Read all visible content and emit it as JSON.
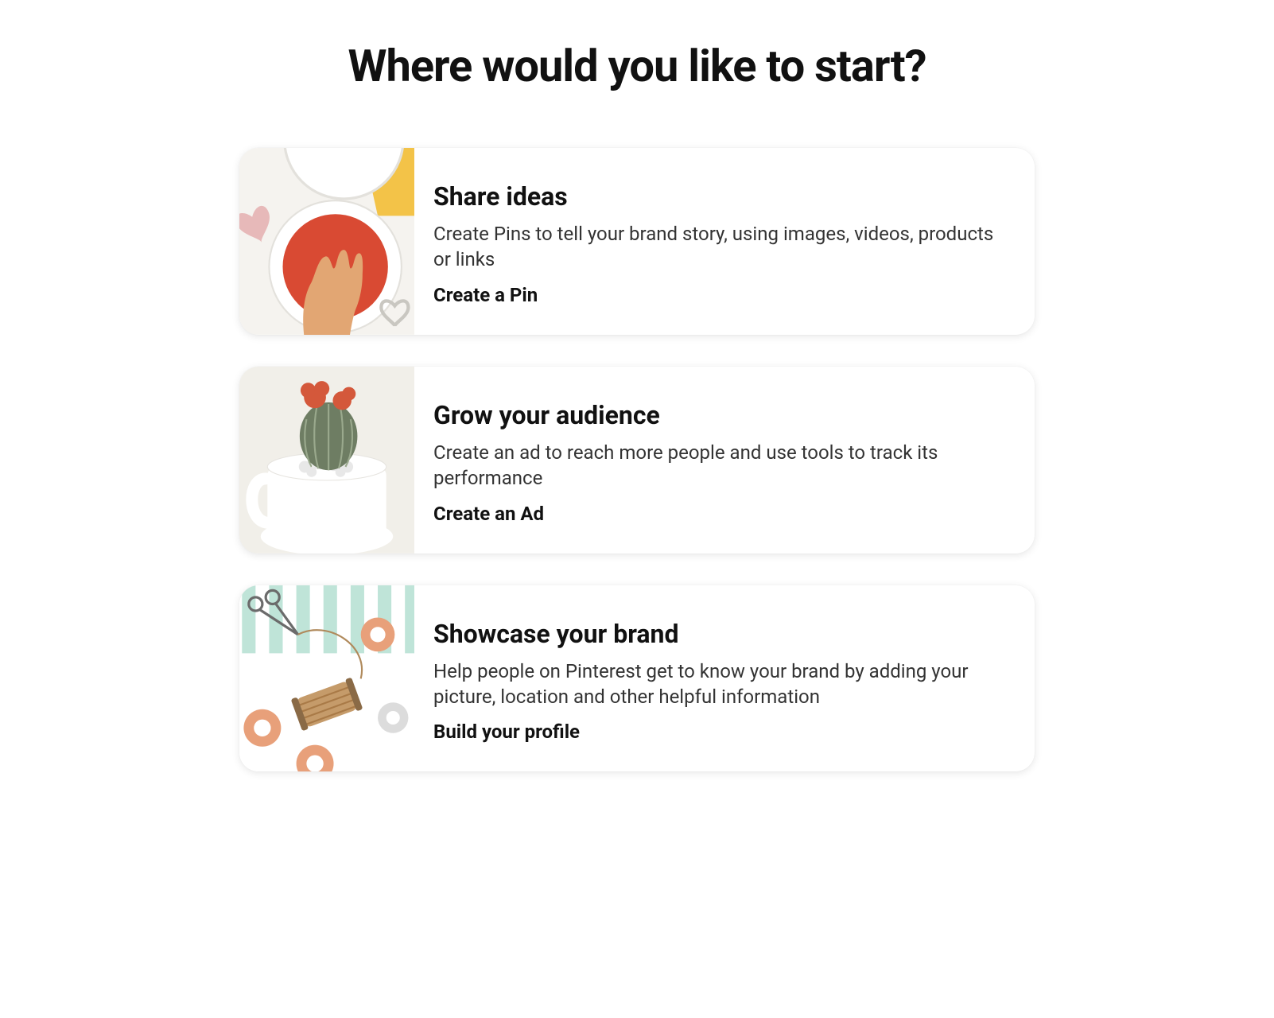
{
  "title": "Where would you like to start?",
  "options": [
    {
      "title": "Share ideas",
      "description": "Create Pins to tell your brand story, using images, videos, products or links",
      "action": "Create a Pin",
      "icon": "paint-icon"
    },
    {
      "title": "Grow your audience",
      "description": "Create an ad to reach more people and use tools to track its performance",
      "action": "Create an Ad",
      "icon": "cactus-icon"
    },
    {
      "title": "Showcase your brand",
      "description": "Help people on Pinterest get to know your brand by adding your picture, location and other helpful information",
      "action": "Build your profile",
      "icon": "craft-icon"
    }
  ]
}
